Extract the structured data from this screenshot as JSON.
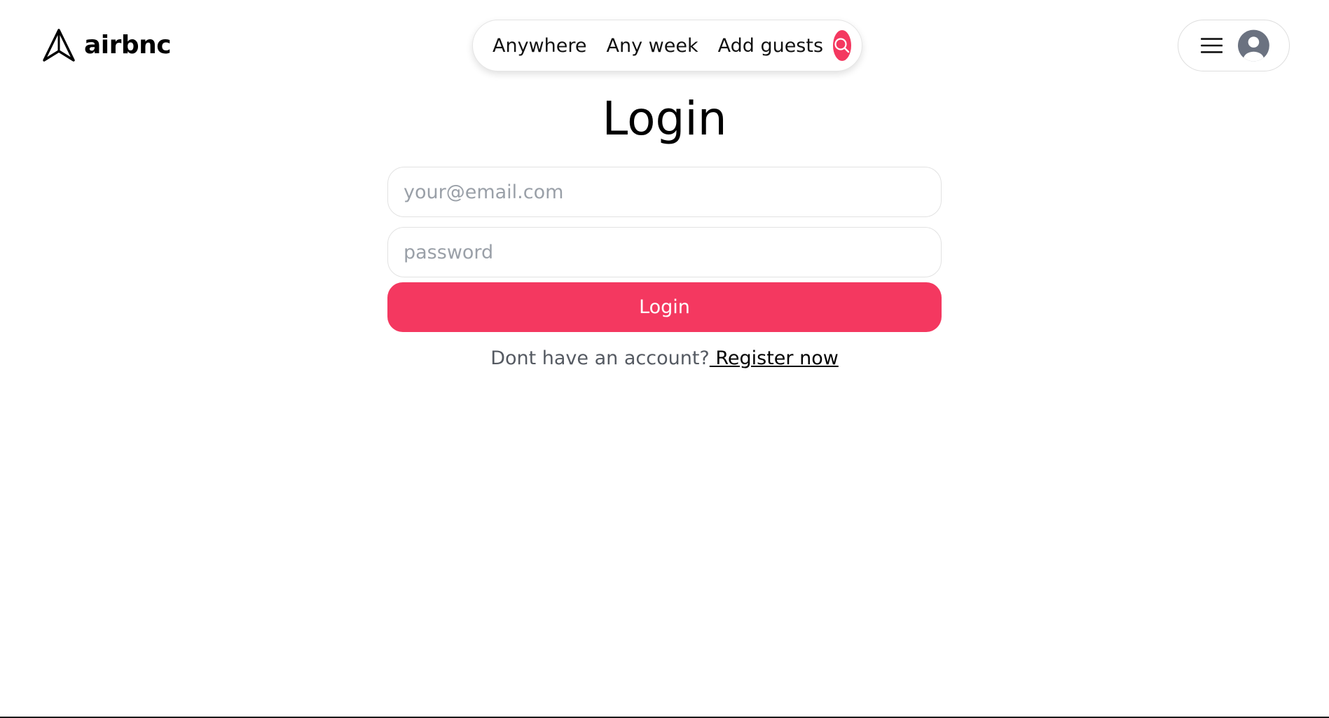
{
  "header": {
    "brand_name": "airbnc",
    "search": {
      "location": "Anywhere",
      "week": "Any week",
      "guests": "Add guests"
    }
  },
  "login": {
    "title": "Login",
    "email_placeholder": "your@email.com",
    "password_placeholder": "password",
    "submit_label": "Login",
    "register_prompt": "Dont have an account?",
    "register_link": " Register now"
  },
  "icons": {
    "logo": "paper-plane-icon",
    "search": "search-icon",
    "menu": "hamburger-icon",
    "avatar": "user-avatar-icon"
  },
  "colors": {
    "accent": "#f43860",
    "background": "#ffffff",
    "placeholder": "#9aa0a8",
    "muted_text": "#555a62"
  }
}
